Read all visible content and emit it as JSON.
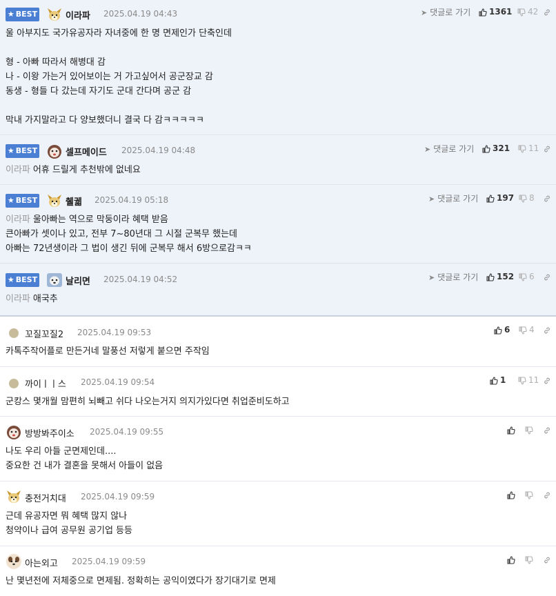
{
  "labels": {
    "best": "BEST",
    "goto_reply": "댓글로 가기"
  },
  "icons": {
    "best": "star-icon",
    "goto": "arrow-icon",
    "up": "thumbs-up-icon",
    "down": "thumbs-down-icon",
    "link": "link-icon"
  },
  "colors": {
    "best_badge": "#4a7fd4",
    "best_bg": "#eef2f9"
  },
  "best_comments": [
    {
      "nick": "이라파",
      "date": "2025.04.19 04:43",
      "up": "1361",
      "down": "42",
      "lines": [
        "울 아부지도 국가유공자라 자녀중에 한 명 면제인가 단축인데",
        "",
        "형 - 아빠 따라서 해병대 감",
        "나 - 이왕 가는거 있어보이는 거 가고싶어서 공군장교 감",
        "동생 - 형들 다 갔는데 자기도 군대 간다며 공군 감",
        "",
        "막내 가지말라고 다 양보했더니 결국 다 감ㅋㅋㅋㅋㅋ"
      ]
    },
    {
      "nick": "셀프메이드",
      "date": "2025.04.19 04:48",
      "up": "321",
      "down": "11",
      "reply_to": "이라파",
      "lines": [
        "어휴 드릴게 추천밖에 없네요"
      ]
    },
    {
      "nick": "췔궯",
      "date": "2025.04.19 05:18",
      "up": "197",
      "down": "8",
      "reply_to": "이라파",
      "lines": [
        "울아빠는 역으로 막둥이라 혜택 받음",
        "큰아빠가 셋이나 있고, 전부 7~80년대 그 시절 군복무 했는데",
        "아빠는 72년생이라 그 법이 생긴 뒤에 군복무 해서 6방으로감ㅋㅋ"
      ]
    },
    {
      "nick": "날리면",
      "date": "2025.04.19 04:52",
      "up": "152",
      "down": "6",
      "reply_to": "이라파",
      "lines": [
        "애국추"
      ]
    }
  ],
  "comments": [
    {
      "nick": "꼬질꼬질2",
      "date": "2025.04.19 09:53",
      "up": "6",
      "down": "4",
      "lines": [
        "카톡주작어플로 만든거네 말풍선 저렇게 붙으면 주작임"
      ]
    },
    {
      "nick": "까이ㅣㅣ스",
      "date": "2025.04.19 09:54",
      "up": "1",
      "down": "11",
      "lines": [
        "군캉스 몇개월 맘편히 뇌빼고 쉬다 나오는거지 의지가있다면 취업준비도하고"
      ]
    },
    {
      "nick": "방방봐주이소",
      "date": "2025.04.19 09:55",
      "up": "",
      "down": "",
      "lines": [
        "나도 우리 아들 군면제인데....",
        "중요한 건 내가 결혼을 못해서 아들이 없음"
      ]
    },
    {
      "nick": "충전거치대",
      "date": "2025.04.19 09:59",
      "up": "",
      "down": "",
      "lines": [
        "근데 유공자면 뭐 혜택 많지 않나",
        "청약이나 급여 공무원 공기업 등등"
      ]
    },
    {
      "nick": "아는외고",
      "date": "2025.04.19 09:59",
      "up": "",
      "down": "",
      "lines": [
        "난 몇년전에 저체중으로 면제됨. 정확히는 공익이였다가 장기대기로 면제"
      ]
    }
  ]
}
